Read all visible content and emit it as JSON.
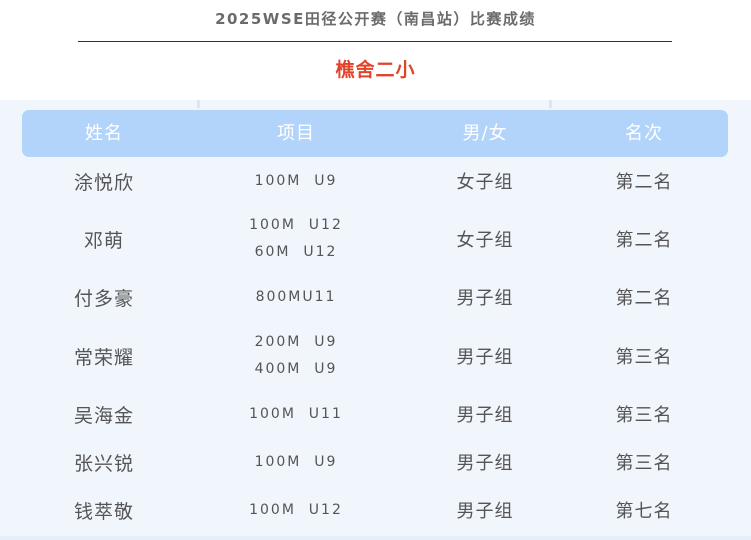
{
  "header": {
    "event_title": "2025WSE田径公开赛（南昌站）比赛成绩",
    "school": "樵舍二小"
  },
  "table": {
    "columns": [
      "姓名",
      "项目",
      "男/女",
      "名次"
    ],
    "rows": [
      {
        "name": "涂悦欣",
        "events": [
          "100M  U9"
        ],
        "group": "女子组",
        "rank": "第二名"
      },
      {
        "name": "邓萌",
        "events": [
          "100M  U12",
          "60M  U12"
        ],
        "group": "女子组",
        "rank": "第二名"
      },
      {
        "name": "付多豪",
        "events": [
          "800MU11"
        ],
        "group": "男子组",
        "rank": "第二名"
      },
      {
        "name": "常荣耀",
        "events": [
          "200M  U9",
          "400M  U9"
        ],
        "group": "男子组",
        "rank": "第三名"
      },
      {
        "name": "吴海金",
        "events": [
          "100M  U11"
        ],
        "group": "男子组",
        "rank": "第三名"
      },
      {
        "name": "张兴锐",
        "events": [
          "100M  U9"
        ],
        "group": "男子组",
        "rank": "第三名"
      },
      {
        "name": "钱萃敬",
        "events": [
          "100M  U12"
        ],
        "group": "男子组",
        "rank": "第七名"
      }
    ]
  }
}
